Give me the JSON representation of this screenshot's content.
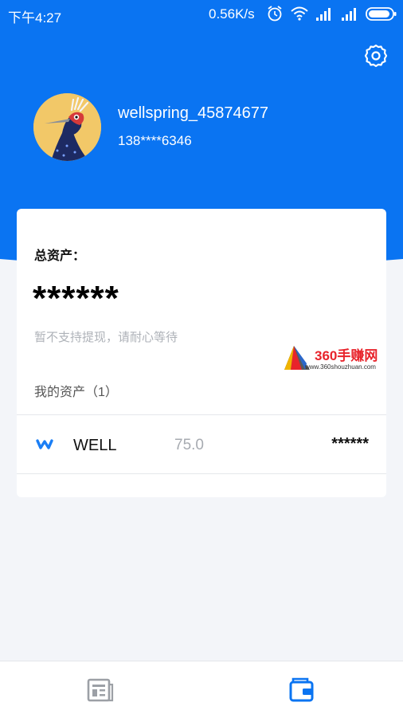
{
  "status_bar": {
    "time": "下午4:27",
    "network_speed": "0.56K/s",
    "icons": [
      "alarm-icon",
      "wifi-icon",
      "signal-icon",
      "signal-icon",
      "battery-icon"
    ]
  },
  "header": {
    "settings_icon": "gear-icon",
    "avatar_icon": "bird-avatar",
    "username": "wellspring_45874677",
    "phone": "138****6346"
  },
  "card": {
    "total_assets_label": "总资产：",
    "total_assets_value": "******",
    "notice": "暂不支持提现，请耐心等待",
    "my_assets_label": "我的资产（1）",
    "assets": [
      {
        "icon": "well-coin-icon",
        "name": "WELL",
        "amount": "75.0",
        "value": "******"
      }
    ]
  },
  "watermark": {
    "text": "360手赚网",
    "subtext": "www.360shouzhuan.com"
  },
  "bottom_nav": {
    "items": [
      {
        "icon": "news-icon",
        "active": false
      },
      {
        "icon": "wallet-icon",
        "active": true
      }
    ]
  },
  "colors": {
    "primary": "#0a74f2",
    "background": "#f3f5f9",
    "inactive_icon": "#9ca0a6",
    "watermark_red": "#e8232b"
  }
}
